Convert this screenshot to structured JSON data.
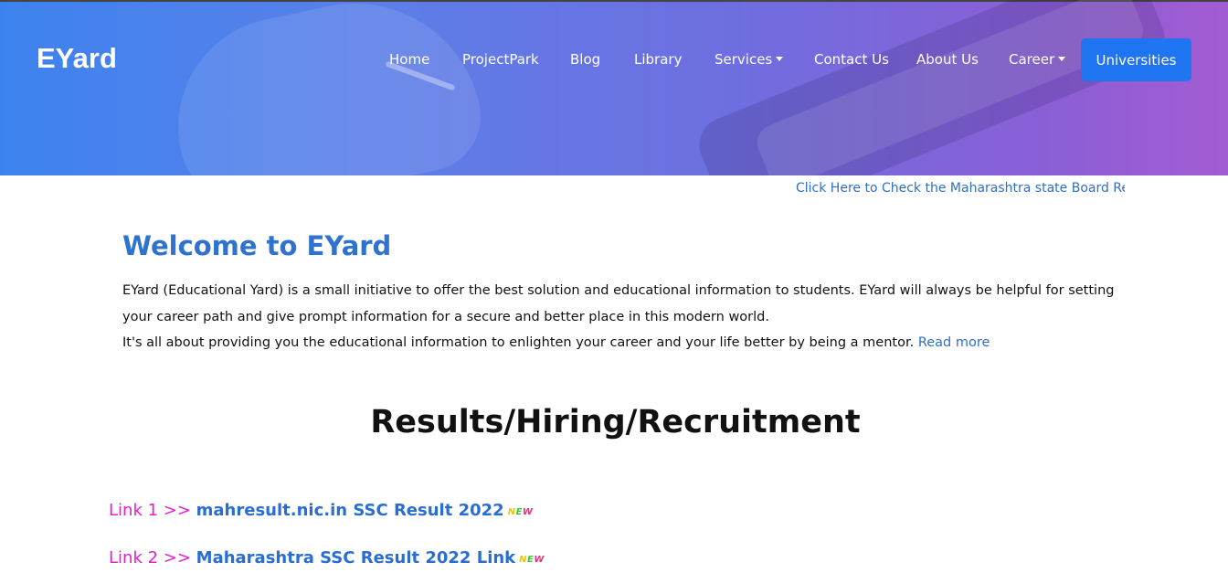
{
  "brand": "EYard",
  "nav": {
    "items": [
      {
        "label": "Home"
      },
      {
        "label": "ProjectPark"
      },
      {
        "label": "Blog"
      },
      {
        "label": "Library"
      },
      {
        "label": "Services"
      },
      {
        "label": "Contact Us"
      },
      {
        "label": "About Us"
      },
      {
        "label": "Career"
      }
    ],
    "cta_label": "Universities"
  },
  "marquee": "Click Here to Check the Maharashtra state Board Resu",
  "welcome": {
    "title": "Welcome to EYard",
    "paragraph1": "EYard (Educational Yard) is a small initiative to offer the best solution and educational information to students. EYard will always be helpful for setting your career path and give prompt information for a secure and better place in this modern world.",
    "paragraph2": "It's all about providing you the educational information to enlighten your career and your life better by being a mentor.",
    "read_more": "Read more"
  },
  "section": {
    "title": "Results/Hiring/Recruitment"
  },
  "links": [
    {
      "prefix": "Link 1 >> ",
      "label": "mahresult.nic.in SSC Result 2022",
      "badge": "NEW"
    },
    {
      "prefix": "Link 2 >> ",
      "label": "Maharashtra SSC Result 2022 Link",
      "badge": "NEW"
    }
  ],
  "colors": {
    "accent": "#1f74f2",
    "link": "#2f6fc5",
    "magenta": "#e01fcf"
  }
}
